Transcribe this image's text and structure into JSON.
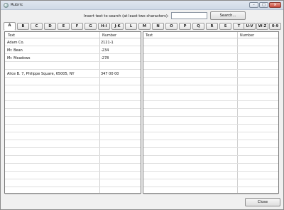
{
  "window": {
    "title": "Rubric"
  },
  "search": {
    "label": "Insert text to search (at least two characters):",
    "value": "",
    "button_label": "Search..."
  },
  "tabs": [
    "A",
    "B",
    "C",
    "D",
    "E",
    "F",
    "G",
    "H-I",
    "J-K",
    "L",
    "M",
    "N",
    "O",
    "P",
    "Q",
    "R",
    "S",
    "T",
    "U-V",
    "W-Z",
    "0-9"
  ],
  "active_tab": "A",
  "left_table": {
    "columns": [
      "Text",
      "Number"
    ],
    "rows": [
      {
        "text": "Adam Co.",
        "number": "2121-1"
      },
      {
        "text": "Mr. Bean",
        "number": "-234"
      },
      {
        "text": "Mr. Meadows",
        "number": "-278"
      },
      {
        "text": "",
        "number": ""
      },
      {
        "text": "Alice B.      7, Philippe Square, 65005, NY",
        "number": "347 00 00"
      }
    ]
  },
  "right_table": {
    "columns": [
      "Text",
      "Number"
    ],
    "rows": []
  },
  "footer": {
    "close_label": "Close"
  }
}
